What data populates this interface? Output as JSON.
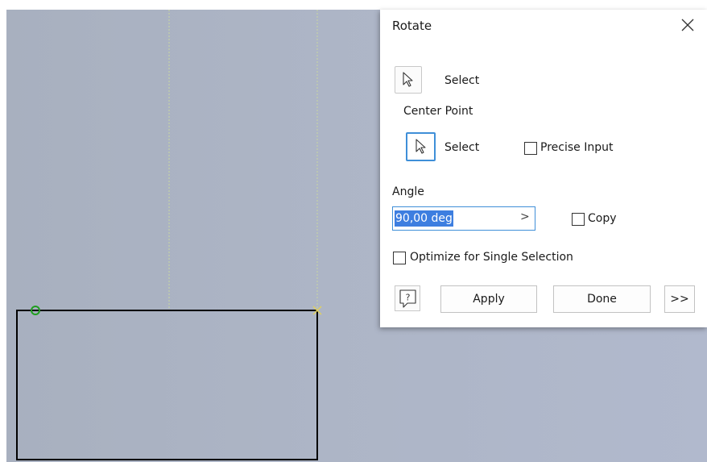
{
  "dialog": {
    "title": "Rotate",
    "select_label": "Select",
    "center_point_heading": "Center Point",
    "center_select_label": "Select",
    "precise_input_label": "Precise Input",
    "angle_heading": "Angle",
    "angle_value": "90,00 deg",
    "copy_label": "Copy",
    "optimize_label": "Optimize for Single Selection",
    "apply_label": "Apply",
    "done_label": "Done",
    "expand_label": ">>",
    "angle_arrow": ">",
    "precise_input_checked": false,
    "copy_checked": false,
    "optimize_checked": false
  },
  "icons": {
    "close": "close-icon",
    "select": "cursor-arrow-icon",
    "center_select": "cursor-arrow-icon",
    "help": "help-icon",
    "center_point_marker": "green-circle-point",
    "corner_marker": "yellow-x-point"
  },
  "colors": {
    "viewport_background": "#adb5c6",
    "sketch_line": "#000000",
    "construction_line": "#c9d7a0",
    "center_point": "#1f9e1f",
    "corner_marker": "#e0d060",
    "active_accent": "#3f8fd8",
    "selection_highlight": "#3d7ee0"
  }
}
